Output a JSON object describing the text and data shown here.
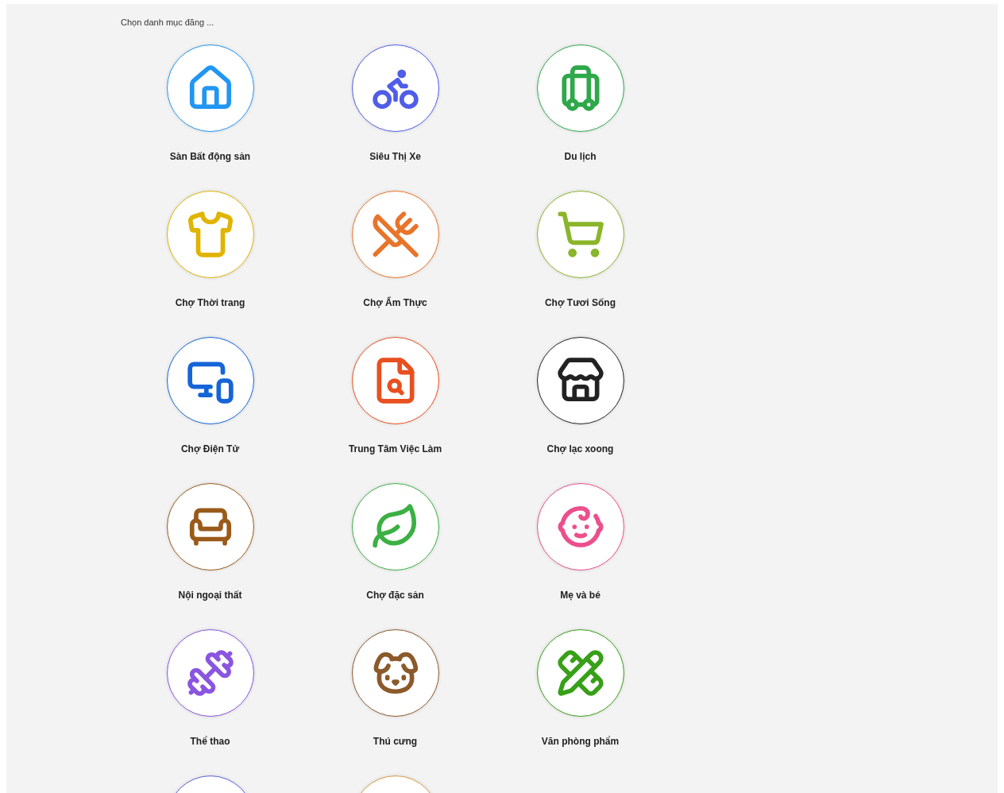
{
  "heading": "Chọn danh mục đăng ...",
  "categories": [
    {
      "label": "Sàn Bất động sản",
      "color": "#2196f3"
    },
    {
      "label": "Siêu Thị Xe",
      "color": "#4f5de8"
    },
    {
      "label": "Du lịch",
      "color": "#2ea84a"
    },
    {
      "label": "Chợ Thời trang",
      "color": "#e0b400"
    },
    {
      "label": "Chợ Ẩm Thực",
      "color": "#e8742a"
    },
    {
      "label": "Chợ Tươi Sống",
      "color": "#8bb52a"
    },
    {
      "label": "Chợ Điện Tử",
      "color": "#1565d8"
    },
    {
      "label": "Trung Tâm Việc Làm",
      "color": "#e85020"
    },
    {
      "label": "Chợ lạc xoong",
      "color": "#222222"
    },
    {
      "label": "Nội ngoại thất",
      "color": "#9a5a1a"
    },
    {
      "label": "Chợ đặc sản",
      "color": "#3cb043"
    },
    {
      "label": "Mẹ và bé",
      "color": "#ec4f8c"
    },
    {
      "label": "Thể thao",
      "color": "#8a55e0"
    },
    {
      "label": "Thú cưng",
      "color": "#8b5a2b"
    },
    {
      "label": "Văn phòng phẩm",
      "color": "#38a018"
    },
    {
      "color": "#5a60d8"
    },
    {
      "color": "#d89a40"
    }
  ]
}
